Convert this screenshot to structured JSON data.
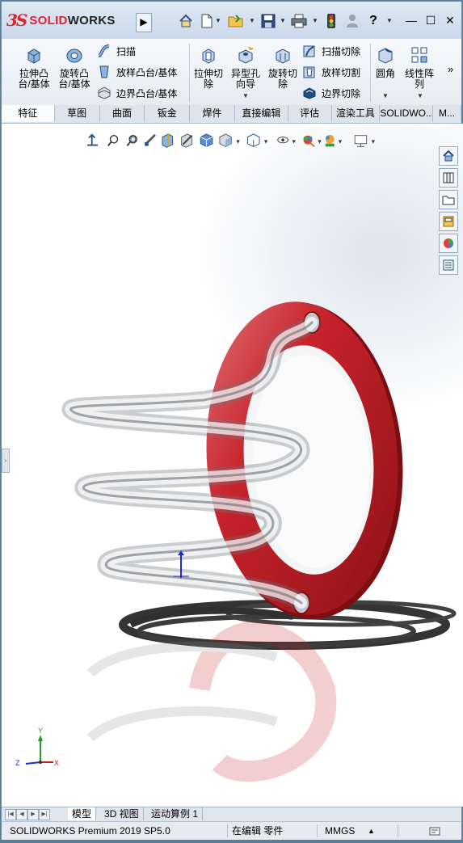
{
  "app": {
    "logo_ds": "3S",
    "logo_solid": "SOLID",
    "logo_works": "WORKS"
  },
  "titlebar": {
    "window_controls": [
      "minimize",
      "maximize",
      "close"
    ],
    "minimize_glyph": "—",
    "maximize_glyph": "☐",
    "close_glyph": "✕",
    "help_glyph": "?"
  },
  "command_manager": {
    "extruded_boss": "拉伸凸台/基体",
    "extruded_boss_l1": "拉伸凸",
    "extruded_boss_l2": "台/基体",
    "revolved_boss_l1": "旋转凸",
    "revolved_boss_l2": "台/基体",
    "sweep": "扫描",
    "loft": "放样凸台/基体",
    "boundary": "边界凸台/基体",
    "extruded_cut_l1": "拉伸切",
    "extruded_cut_l2": "除",
    "hole_wizard_l1": "异型孔",
    "hole_wizard_l2": "向导",
    "revolved_cut_l1": "旋转切",
    "revolved_cut_l2": "除",
    "swept_cut": "扫描切除",
    "lofted_cut": "放样切割",
    "boundary_cut": "边界切除",
    "fillet": "圆角",
    "linear_pattern_l1": "线性阵",
    "linear_pattern_l2": "列"
  },
  "tabs": [
    "特征",
    "草图",
    "曲面",
    "钣金",
    "焊件",
    "直接编辑",
    "评估",
    "渲染工具",
    "SOLIDWO...",
    "M..."
  ],
  "active_tab": "特征",
  "model_tabs": [
    "模型",
    "3D 视图",
    "运动算例 1"
  ],
  "active_model_tab": "模型",
  "status": {
    "product": "SOLIDWORKS Premium 2019 SP5.0",
    "mode": "在编辑 零件",
    "units": "MMGS",
    "units_caret": "▲"
  },
  "triad": {
    "x": "X",
    "y": "Y",
    "z": "Z"
  },
  "colors": {
    "ring": "#c8232b",
    "brand_red": "#d9252b",
    "spring_glass": "#9aa3ab"
  }
}
